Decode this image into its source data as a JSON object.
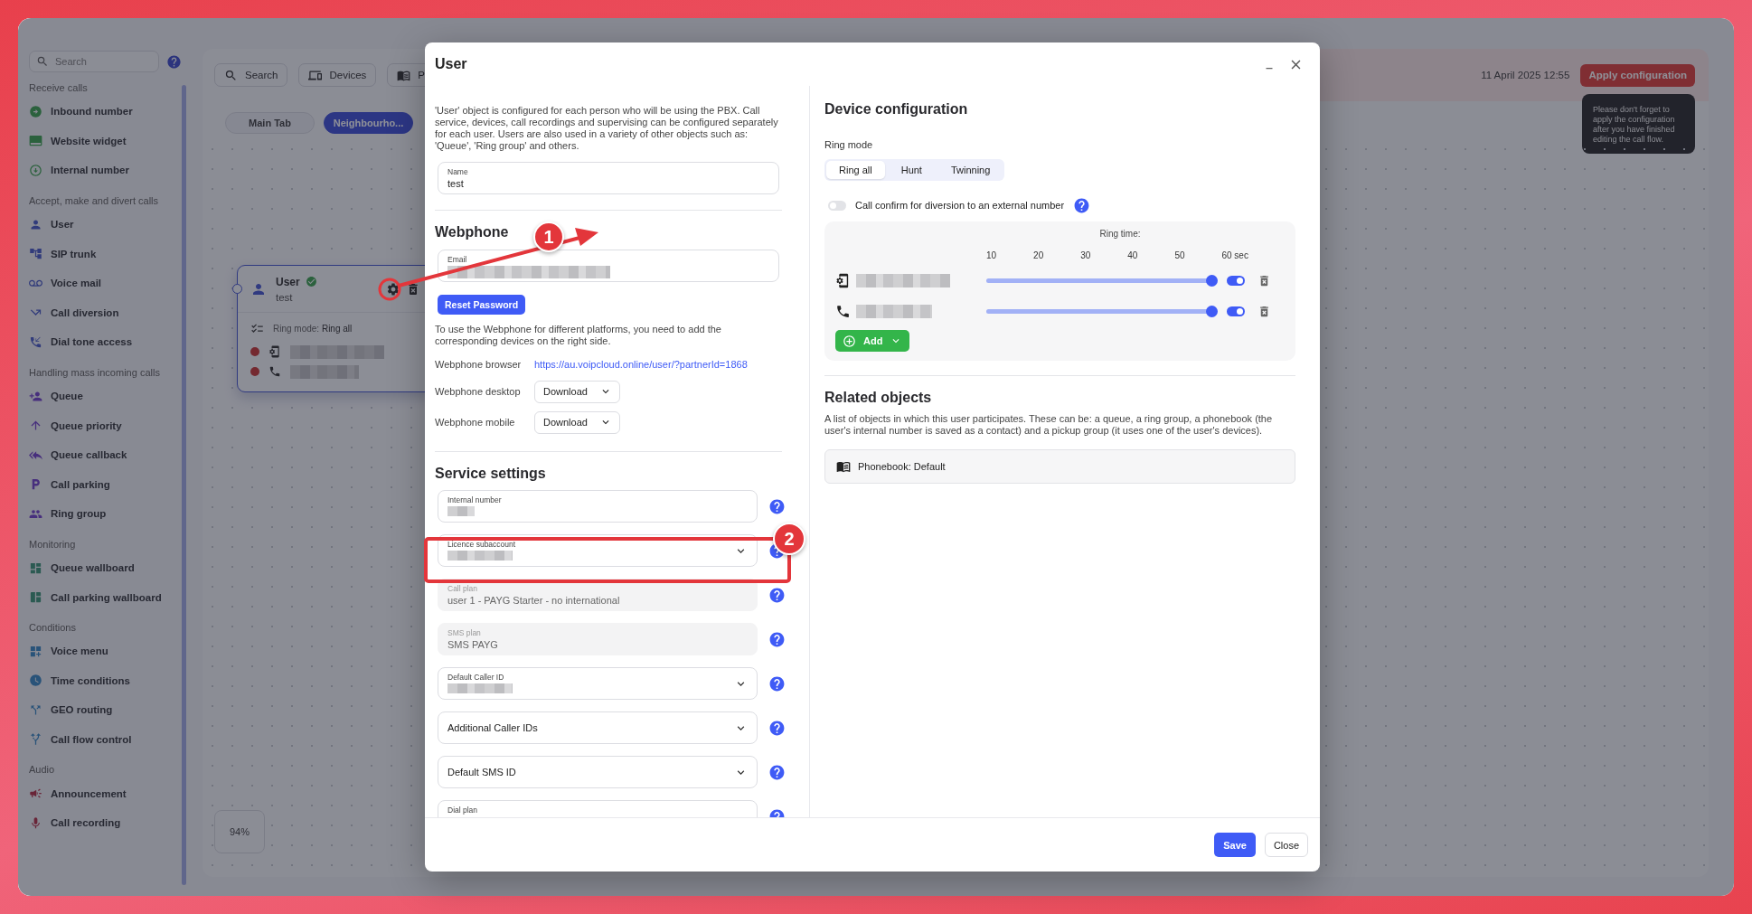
{
  "sidebar": {
    "search": {
      "placeholder": "Search"
    },
    "groups": [
      {
        "title": "Receive calls",
        "items": [
          {
            "label": "Inbound number"
          },
          {
            "label": "Website widget"
          },
          {
            "label": "Internal number"
          }
        ]
      },
      {
        "title": "Accept, make and divert calls",
        "items": [
          {
            "label": "User"
          },
          {
            "label": "SIP trunk"
          },
          {
            "label": "Voice mail"
          },
          {
            "label": "Call diversion"
          },
          {
            "label": "Dial tone access"
          }
        ]
      },
      {
        "title": "Handling mass incoming calls",
        "items": [
          {
            "label": "Queue"
          },
          {
            "label": "Queue priority"
          },
          {
            "label": "Queue callback"
          },
          {
            "label": "Call parking"
          },
          {
            "label": "Ring group"
          }
        ]
      },
      {
        "title": "Monitoring",
        "items": [
          {
            "label": "Queue wallboard"
          },
          {
            "label": "Call parking wallboard"
          }
        ]
      },
      {
        "title": "Conditions",
        "items": [
          {
            "label": "Voice menu"
          },
          {
            "label": "Time conditions"
          },
          {
            "label": "GEO routing"
          },
          {
            "label": "Call flow control"
          }
        ]
      },
      {
        "title": "Audio",
        "items": [
          {
            "label": "Announcement"
          },
          {
            "label": "Call recording"
          }
        ]
      }
    ]
  },
  "toolbar": [
    {
      "label": "Search"
    },
    {
      "label": "Devices"
    },
    {
      "label": "P"
    }
  ],
  "tabs": [
    {
      "label": "Main Tab",
      "selected": false
    },
    {
      "label": "Neighbourho...",
      "selected": true
    }
  ],
  "canvas_node": {
    "title": "User",
    "verified": true,
    "subtitle": "test",
    "ring_mode_label": "Ring mode:",
    "ring_mode": "Ring all",
    "devices": [
      {
        "kind": "sip-phone"
      },
      {
        "kind": "phone"
      }
    ]
  },
  "zoom": "94%",
  "header": {
    "datetime": "11 April 2025 12:55",
    "apply_button": "Apply configuration",
    "tooltip": "Please don't forget to apply the configuration after you have finished editing the call flow."
  },
  "modal": {
    "title": "User",
    "description": "'User' object is configured for each person who will be using the PBX. Call service, devices, call recordings and supervising can be configured separately for each user. Users are also used in a variety of other objects such as: 'Queue', 'Ring group' and others.",
    "name_field": {
      "label": "Name",
      "value": "test"
    },
    "webphone": {
      "heading": "Webphone",
      "email_field": {
        "label": "Email"
      },
      "reset_button": "Reset Password",
      "note": "To use the Webphone for different platforms, you need to add the corresponding devices on the right side.",
      "rows": [
        {
          "label": "Webphone browser",
          "kind": "link",
          "value": "https://au.voipcloud.online/user/?partnerId=1868"
        },
        {
          "label": "Webphone desktop",
          "kind": "dropdown",
          "value": "Download"
        },
        {
          "label": "Webphone mobile",
          "kind": "dropdown",
          "value": "Download"
        }
      ]
    },
    "service": {
      "heading": "Service settings",
      "fields": [
        {
          "label": "Internal number",
          "kind": "text",
          "blurred": true,
          "disabled": false
        },
        {
          "label": "Licence subaccount",
          "kind": "select",
          "blurred": true,
          "disabled": false
        },
        {
          "label": "Call plan",
          "kind": "text",
          "value": "user 1 - PAYG Starter - no international",
          "blurred": false,
          "disabled": true
        },
        {
          "label": "SMS plan",
          "kind": "text",
          "value": "SMS PAYG",
          "blurred": false,
          "disabled": true
        },
        {
          "label": "Default Caller ID",
          "kind": "select",
          "blurred": true,
          "disabled": false
        },
        {
          "label": "Additional Caller IDs",
          "kind": "select",
          "blurred": false,
          "disabled": false
        },
        {
          "label": "Default SMS ID",
          "kind": "select",
          "blurred": false,
          "disabled": false
        },
        {
          "label": "Dial plan",
          "kind": "text",
          "blurred": false,
          "disabled": false
        }
      ]
    },
    "device_config": {
      "heading": "Device configuration",
      "ring_mode_label": "Ring mode",
      "ring_modes": [
        {
          "label": "Ring all",
          "selected": true
        },
        {
          "label": "Hunt",
          "selected": false
        },
        {
          "label": "Twinning",
          "selected": false
        }
      ],
      "call_confirm": {
        "label": "Call confirm for diversion to an external number",
        "on": false
      },
      "ring_time_label": "Ring time:",
      "ticks": [
        "10",
        "20",
        "30",
        "40",
        "50",
        "60 sec"
      ],
      "devices": [
        {
          "kind": "sip-phone",
          "level": 1,
          "on": true
        },
        {
          "kind": "phone",
          "level": 1,
          "on": true
        }
      ],
      "add_button": "Add"
    },
    "related": {
      "heading": "Related objects",
      "description": "A list of objects in which this user participates. These can be: a queue, a ring group, a phonebook (the user's internal number is saved as a contact) and a pickup group (it uses one of the user's devices).",
      "items": [
        {
          "label": "Phonebook: Default"
        }
      ]
    },
    "footer": {
      "save": "Save",
      "close": "Close"
    }
  },
  "annotations": [
    {
      "number": "1"
    },
    {
      "number": "2"
    }
  ]
}
